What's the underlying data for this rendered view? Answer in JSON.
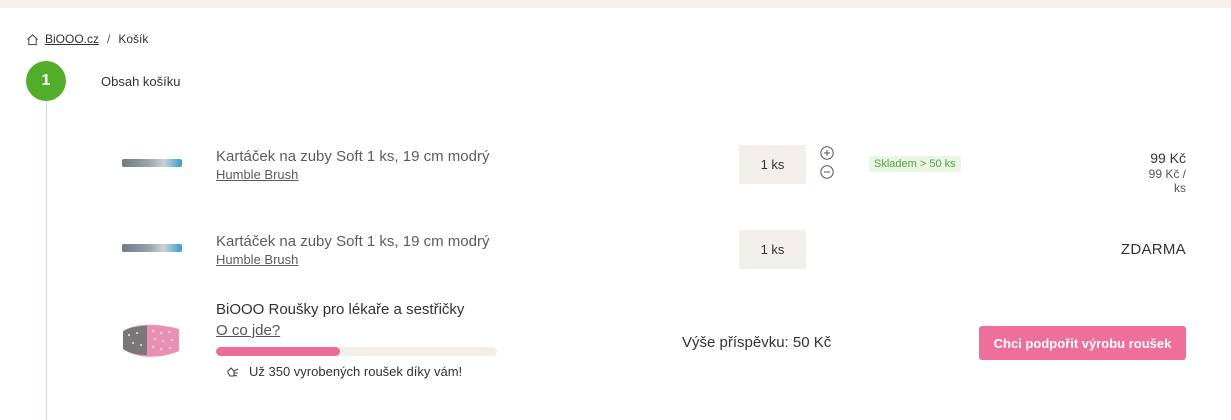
{
  "breadcrumb": {
    "home_label": "BiOOO.cz",
    "separator": "/",
    "current": "Košík"
  },
  "step": {
    "number": "1",
    "title": "Obsah košíku"
  },
  "cart": {
    "items": [
      {
        "name": "Kartáček na zuby Soft 1 ks, 19 cm modrý",
        "brand": "Humble Brush",
        "quantity": "1 ks",
        "stock": "Skladem > 50 ks",
        "price": "99 Kč",
        "unit_price": "99 Kč / ks"
      },
      {
        "name": "Kartáček na zuby Soft 1 ks, 19 cm modrý",
        "brand": "Humble Brush",
        "quantity": "1 ks",
        "price": "ZDARMA"
      }
    ],
    "donation": {
      "title": "BiOOO Roušky pro lékaře a sestřičky",
      "link": "O co jde?",
      "progress": 0.44,
      "note": "Už 350 vyrobených roušek díky vám!",
      "contribution": "Výše příspěvku: 50 Kč",
      "button": "Chci podpořit výrobu roušek"
    }
  },
  "icons": {
    "home": "home-icon",
    "plus": "plus-icon",
    "minus": "minus-icon",
    "hand": "hand-icon"
  },
  "colors": {
    "step": "#52ae29",
    "accent_pink": "#ee6f9a",
    "stock_green": "#52a33c",
    "qty_bg": "#f2efea"
  }
}
